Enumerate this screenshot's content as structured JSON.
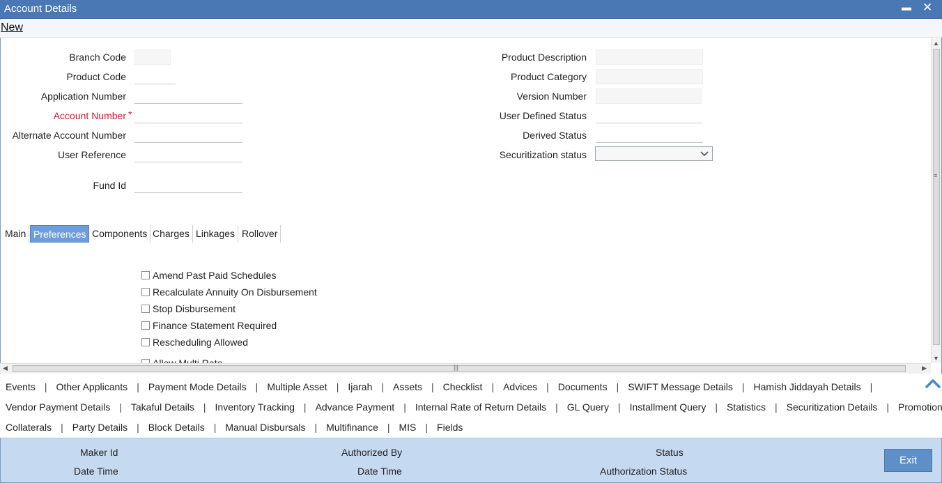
{
  "window": {
    "title": "Account Details",
    "minimize_glyph": "▬",
    "close_glyph": "✕"
  },
  "toolbar": {
    "new_label": "New"
  },
  "form": {
    "left": {
      "branch_code": {
        "label": "Branch Code",
        "value": ""
      },
      "product_code": {
        "label": "Product Code",
        "value": ""
      },
      "application_number": {
        "label": "Application Number",
        "value": ""
      },
      "account_number": {
        "label": "Account Number",
        "value": "",
        "required_mark": "*"
      },
      "alternate_account_number": {
        "label": "Alternate Account Number",
        "value": ""
      },
      "user_reference": {
        "label": "User Reference",
        "value": ""
      },
      "fund_id": {
        "label": "Fund Id",
        "value": ""
      }
    },
    "right": {
      "product_description": {
        "label": "Product Description",
        "value": ""
      },
      "product_category": {
        "label": "Product Category",
        "value": ""
      },
      "version_number": {
        "label": "Version Number",
        "value": ""
      },
      "user_defined_status": {
        "label": "User Defined Status",
        "value": ""
      },
      "derived_status": {
        "label": "Derived Status",
        "value": ""
      },
      "securitization_status": {
        "label": "Securitization status",
        "selected": ""
      }
    }
  },
  "tabs": [
    {
      "label": "Main",
      "active": false
    },
    {
      "label": "Preferences",
      "active": true
    },
    {
      "label": "Components",
      "active": false
    },
    {
      "label": "Charges",
      "active": false
    },
    {
      "label": "Linkages",
      "active": false
    },
    {
      "label": "Rollover",
      "active": false
    }
  ],
  "preferences": [
    {
      "label": "Amend Past Paid Schedules",
      "checked": false
    },
    {
      "label": "Recalculate Annuity On Disbursement",
      "checked": false
    },
    {
      "label": "Stop Disbursement",
      "checked": false
    },
    {
      "label": "Finance Statement Required",
      "checked": false
    },
    {
      "label": "Rescheduling Allowed",
      "checked": false
    },
    {
      "label": "Allow Multi Rate",
      "checked": false
    }
  ],
  "link_rows": [
    [
      "Events",
      "Other Applicants",
      "Payment Mode Details",
      "Multiple Asset",
      "Ijarah",
      "Assets",
      "Checklist",
      "Advices",
      "Documents",
      "SWIFT Message Details",
      "Hamish Jiddayah Details"
    ],
    [
      "Vendor Payment Details",
      "Takaful Details",
      "Inventory Tracking",
      "Advance Payment",
      "Internal Rate of Return Details",
      "GL Query",
      "Installment Query",
      "Statistics",
      "Securitization Details",
      "Promotions"
    ],
    [
      "Collaterals",
      "Party Details",
      "Block Details",
      "Manual Disbursals",
      "Multifinance",
      "MIS",
      "Fields"
    ]
  ],
  "footer": {
    "maker_id": "Maker Id",
    "date_time_1": "Date Time",
    "authorized_by": "Authorized By",
    "date_time_2": "Date Time",
    "status": "Status",
    "authorization_status": "Authorization Status",
    "exit_label": "Exit"
  },
  "colors": {
    "titlebar": "#4a78b5",
    "active_tab": "#6d9edb",
    "footer_bg": "#c5daf0",
    "exit_button": "#5e8fc7",
    "required": "#d11a2a"
  }
}
